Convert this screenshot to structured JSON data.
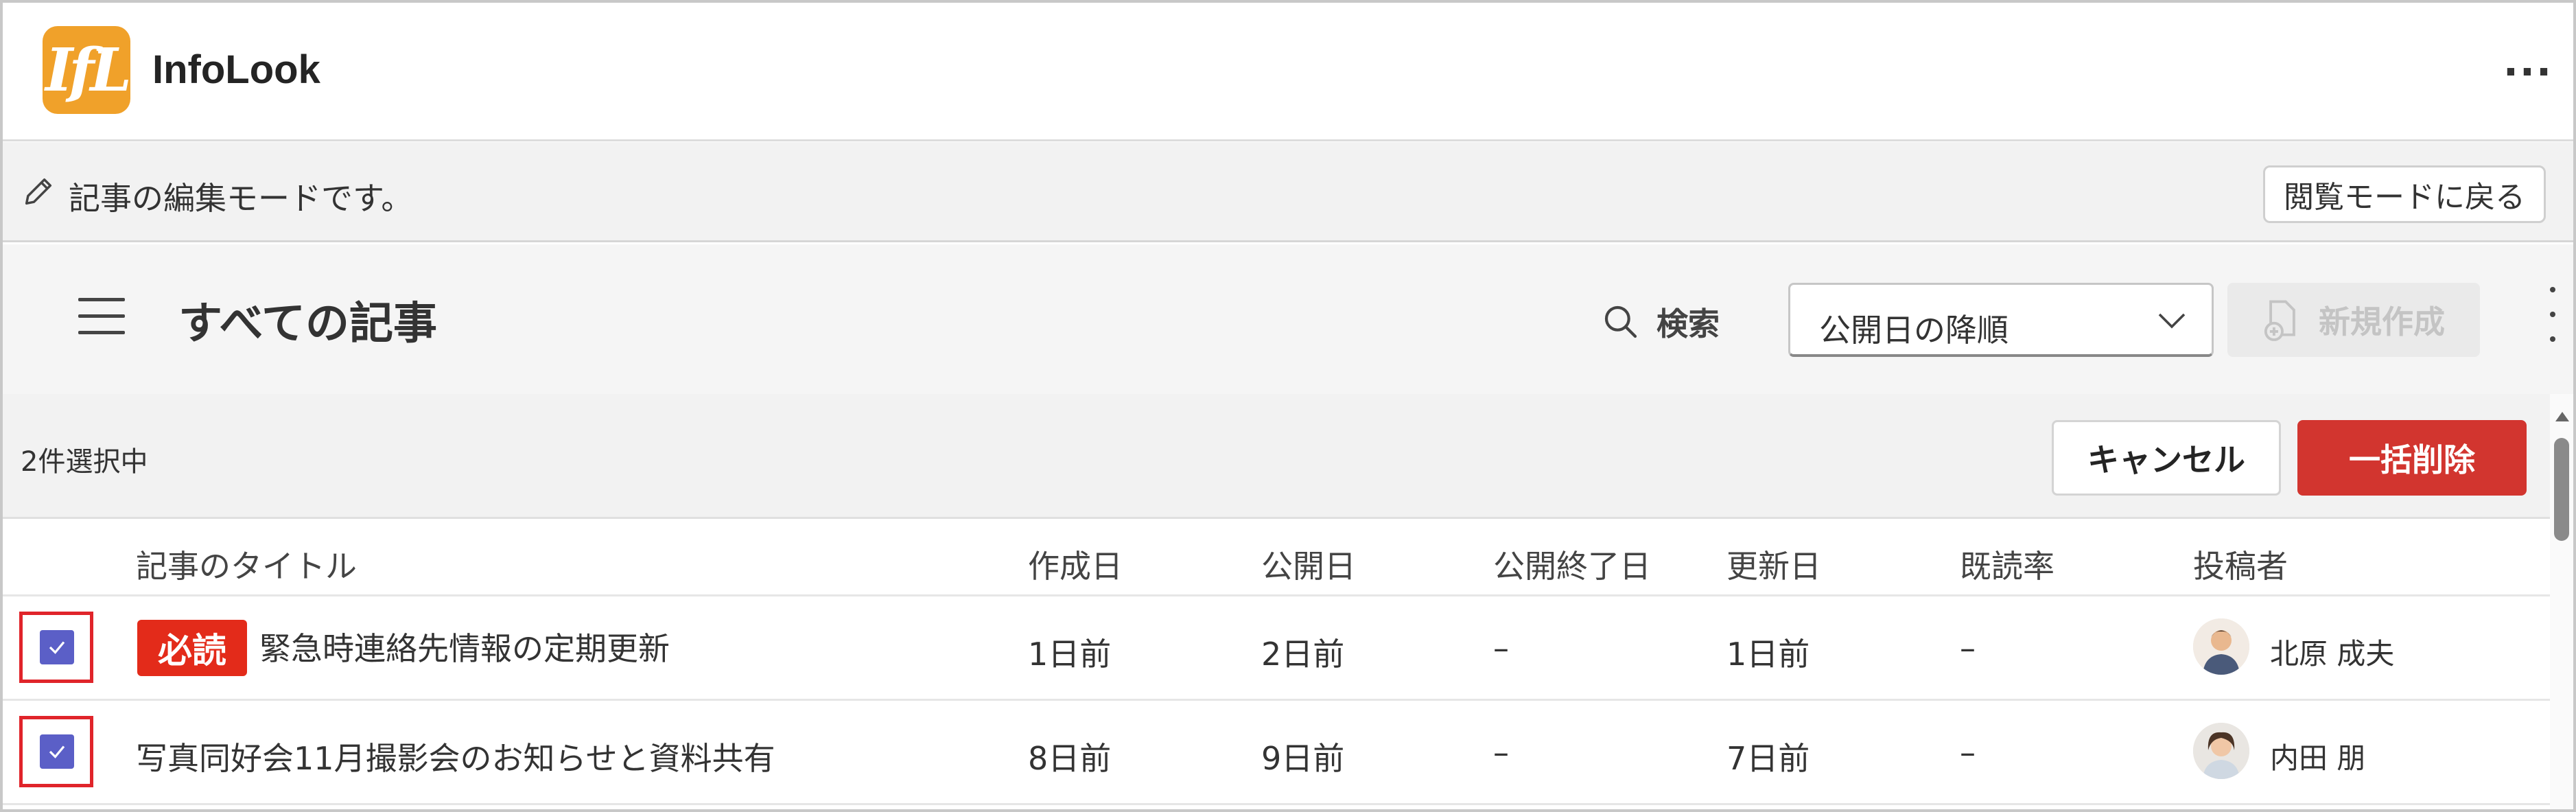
{
  "app": {
    "title": "InfoLook",
    "logo_text": "IfL",
    "more_label": "..."
  },
  "edit_bar": {
    "message": "記事の編集モードです。",
    "back_button": "閲覧モードに戻る"
  },
  "toolbar": {
    "page_title": "すべての記事",
    "search_label": "検索",
    "sort_value": "公開日の降順",
    "new_button": "新規作成"
  },
  "selection": {
    "count_text": "2件選択中",
    "cancel_button": "キャンセル",
    "delete_button": "一括削除"
  },
  "table": {
    "headers": [
      "記事のタイトル",
      "作成日",
      "公開日",
      "公開終了日",
      "更新日",
      "既読率",
      "投稿者"
    ],
    "rows": [
      {
        "checked": true,
        "badge": "必読",
        "title": "緊急時連絡先情報の定期更新",
        "created": "1日前",
        "published": "2日前",
        "end": "–",
        "updated": "1日前",
        "read_rate": "–",
        "author": "北原 成夫"
      },
      {
        "checked": true,
        "badge": "",
        "title": "写真同好会11月撮影会のお知らせと資料共有",
        "created": "8日前",
        "published": "9日前",
        "end": "–",
        "updated": "7日前",
        "read_rate": "–",
        "author": "内田 朋"
      }
    ]
  },
  "colors": {
    "accent": "#5b5fc7",
    "danger": "#d2352f",
    "badge": "#e32b1a",
    "logo": "#f0a12a"
  }
}
